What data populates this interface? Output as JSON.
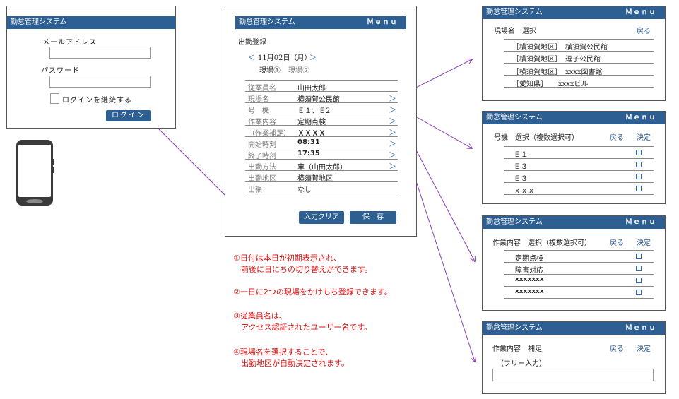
{
  "colors": {
    "header": "#2e5f92",
    "arrow": "#8a3fb4",
    "note": "#e01010",
    "link": "#2e6ab6"
  },
  "login": {
    "title": "勤怠管理システム",
    "email_label": "メールアドレス",
    "password_label": "パスワード",
    "keep_login_label": "ログインを継続する",
    "login_button": "ログイン"
  },
  "phone": {
    "icon": "smartphone-icon"
  },
  "main": {
    "title": "勤怠管理システム",
    "menu": "Ｍｅｎｕ",
    "page_title": "出勤登録",
    "prev": "＜",
    "date": "11月02日（月）",
    "next": "＞",
    "site1": "現場①",
    "site2": "現場②",
    "rows": [
      {
        "label": "従業員名",
        "value": "山田太郎",
        "arrow": ""
      },
      {
        "label": "現場名",
        "value": "横須賀公民館",
        "arrow": "＞"
      },
      {
        "label": "号　機",
        "value": "Ｅ１、Ｅ2",
        "arrow": "＞"
      },
      {
        "label": "作業内容",
        "value": "定期点検",
        "arrow": "＞"
      },
      {
        "label": "（作業補足）",
        "value": "ＸＸＸＸ",
        "arrow": "＞"
      },
      {
        "label": "開始時刻",
        "value": "08:31",
        "arrow": "＞"
      },
      {
        "label": "終了時刻",
        "value": "17:35",
        "arrow": "＞"
      },
      {
        "label": "出勤方法",
        "value": "車（山田太郎）",
        "arrow": "＞"
      },
      {
        "label": "出勤地区",
        "value": "横須賀地区",
        "arrow": ""
      },
      {
        "label": "出張",
        "value": "なし",
        "arrow": ""
      }
    ],
    "clear_button": "入力クリア",
    "save_button": "保　存"
  },
  "notes": [
    "①日付は本日が初期表示され、",
    "　前後に日にちの切り替えができます。",
    "②一日に2つの現場をかけもち登録できます。",
    "③従業員名は、",
    "　アクセス認証されたユーザー名です。",
    "④現場名を選択することで、",
    "　出勤地区が自動決定されます。"
  ],
  "site_select": {
    "title": "勤怠管理システム",
    "menu": "Ｍｅｎｕ",
    "heading": "現場名　選択",
    "back": "戻る",
    "items": [
      "［横須賀地区］　横須賀公民館",
      "［横須賀地区］　逗子公民館",
      "［横須賀地区］　xxxx図書館",
      "［愛知県］　　xxxxビル"
    ]
  },
  "unit_select": {
    "title": "勤怠管理システム",
    "menu": "Ｍｅｎｕ",
    "heading": "号機　選択（複数選択可）",
    "back": "戻る",
    "ok": "決定",
    "items": [
      "Ｅ１",
      "Ｅ３",
      "Ｅ３",
      "ｘｘｘ"
    ]
  },
  "work_select": {
    "title": "勤怠管理システム",
    "menu": "Ｍｅｎｕ",
    "heading": "作業内容　選択（複数選択可）",
    "back": "戻る",
    "ok": "決定",
    "items": [
      "定期点検",
      "障害対応",
      "xxxxxxx",
      "xxxxxxx"
    ]
  },
  "work_note": {
    "title": "勤怠管理システム",
    "menu": "Ｍｅｎｕ",
    "heading": "作業内容　補足",
    "back": "戻る",
    "ok": "決定",
    "free_label": "（フリー入力）"
  }
}
